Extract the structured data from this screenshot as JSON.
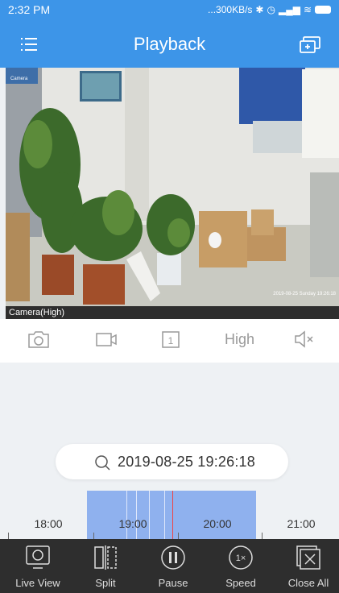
{
  "status": {
    "time": "2:32 PM",
    "net": "...300KB/s"
  },
  "header": {
    "title": "Playback",
    "menu_icon": "menu-icon",
    "right_icon": "cast-icon"
  },
  "video": {
    "camera_label": "Camera(High)",
    "osd_top_left": "Camera",
    "osd_timestamp": "2019-08-25 Sunday 19:26:18"
  },
  "controls": {
    "quality": "High",
    "channel": "1"
  },
  "search": {
    "datetime": "2019-08-25 19:26:18"
  },
  "timeline": {
    "labels": [
      "18:00",
      "19:00",
      "20:00",
      "21:00"
    ]
  },
  "bottom_nav": [
    {
      "label": "Live View",
      "icon": "monitor-icon"
    },
    {
      "label": "Split",
      "icon": "split-icon"
    },
    {
      "label": "Pause",
      "icon": "pause-icon"
    },
    {
      "label": "Speed",
      "icon": "speed-icon"
    },
    {
      "label": "Close All",
      "icon": "close-all-icon"
    }
  ],
  "colors": {
    "header": "#3d95e8",
    "timeline_range": "#8fb1ee",
    "bottom_bar": "#2e2e2e",
    "now_marker": "#e44444"
  }
}
